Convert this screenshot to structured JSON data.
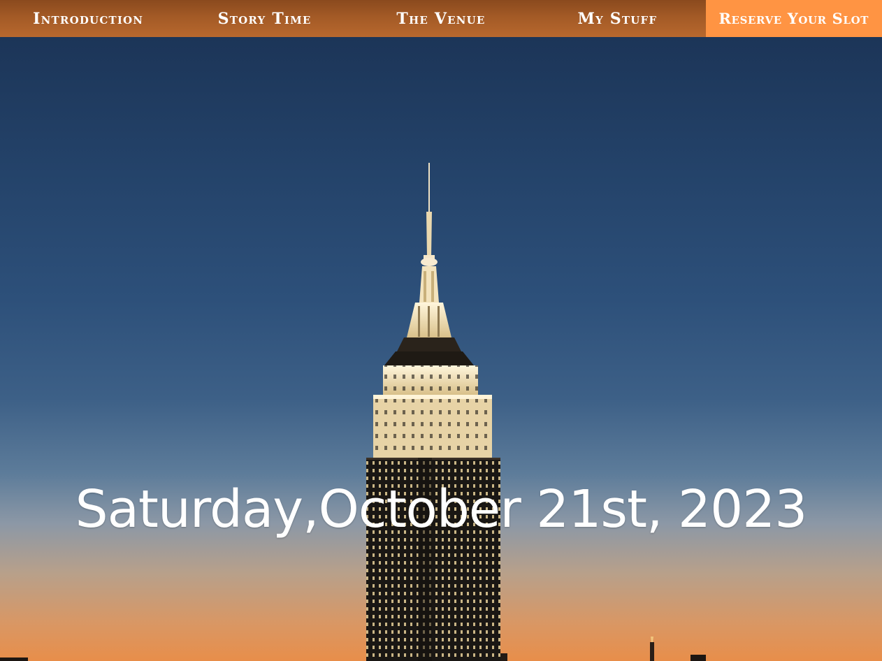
{
  "nav": {
    "items": [
      {
        "label": "Introduction"
      },
      {
        "label": "Story Time"
      },
      {
        "label": "The Venue"
      },
      {
        "label": "My Stuff"
      }
    ],
    "cta_label": "Reserve Your Slot"
  },
  "hero": {
    "image": "empire-state-building-at-dusk",
    "date": "Saturday,October 21st, 2023"
  },
  "colors": {
    "nav_bg": "#a35a26",
    "cta_bg": "#ff9443",
    "text": "#ffffff",
    "sky_top": "#1c3558",
    "sky_horizon": "#e88e4a"
  }
}
